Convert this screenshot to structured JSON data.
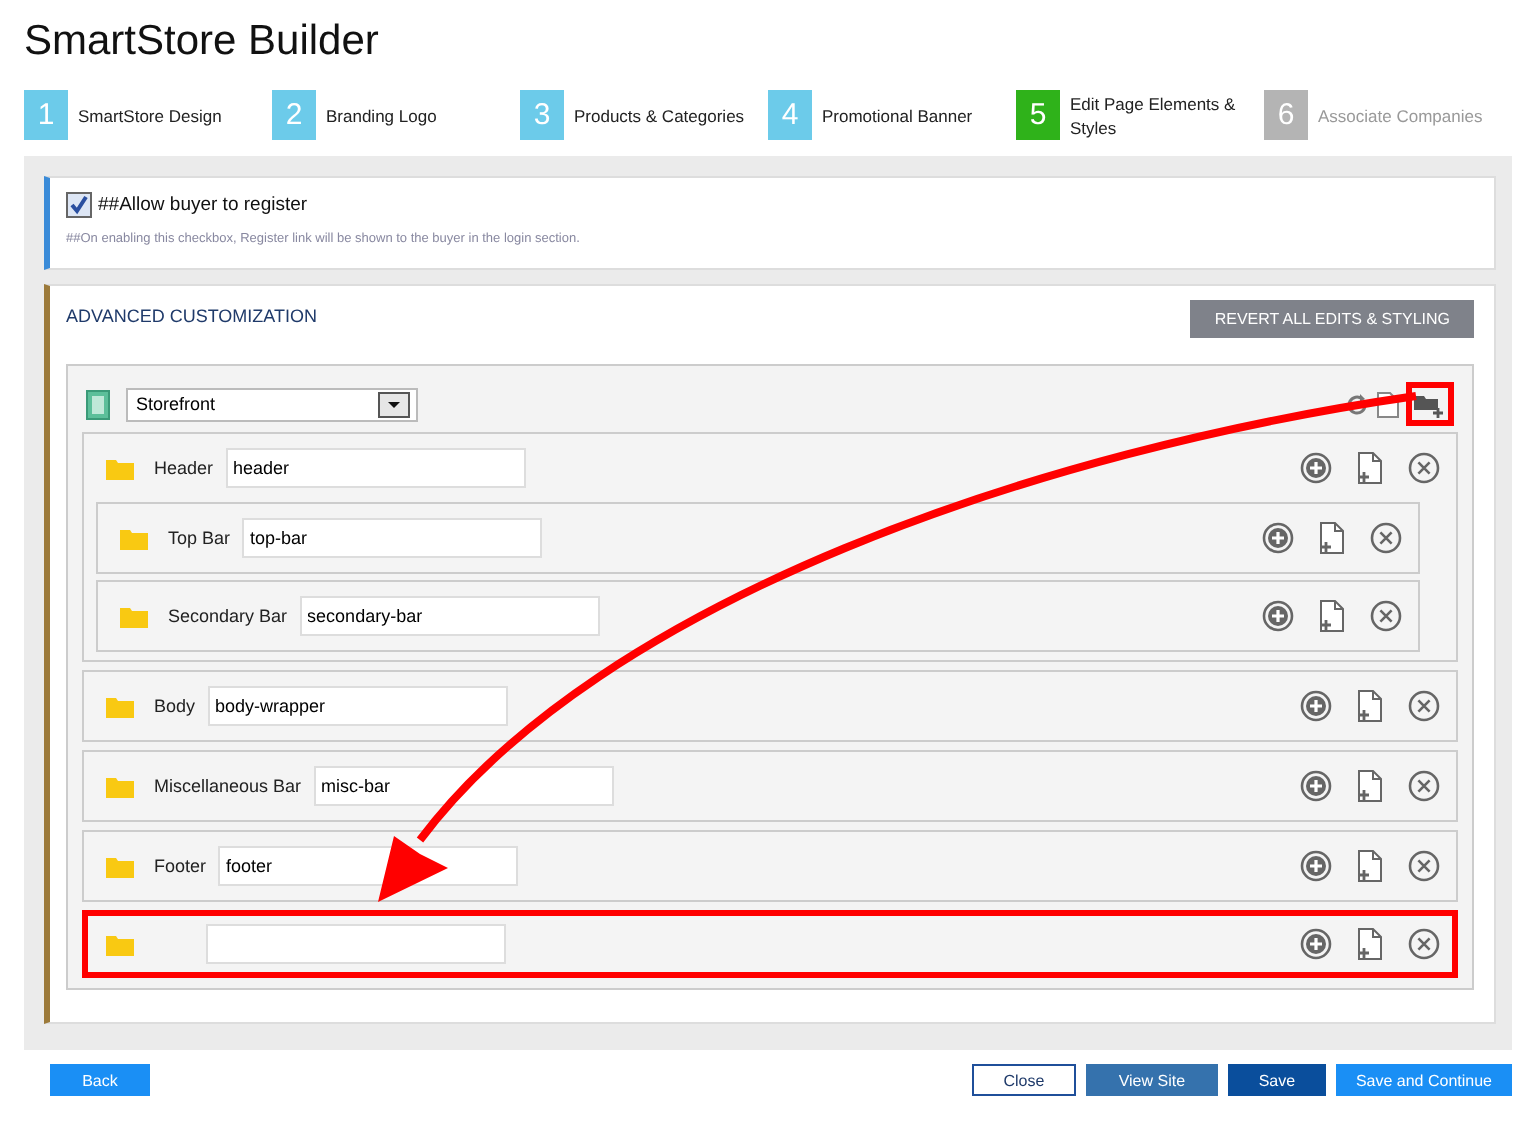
{
  "title": "SmartStore Builder",
  "steps": [
    {
      "number": "1",
      "label": "SmartStore Design",
      "selected": false,
      "disabled": false
    },
    {
      "number": "2",
      "label": "Branding Logo",
      "selected": false,
      "disabled": false
    },
    {
      "number": "3",
      "label": "Products & Categories",
      "selected": false,
      "disabled": false
    },
    {
      "number": "4",
      "label": "Promotional Banner",
      "selected": false,
      "disabled": false
    },
    {
      "number": "5",
      "label": "Edit Page Elements & Styles",
      "selected": true,
      "disabled": false
    },
    {
      "number": "6",
      "label": "Associate Companies",
      "selected": false,
      "disabled": true
    }
  ],
  "register": {
    "label": "##Allow buyer to register",
    "checked": true,
    "note": "##On enabling this checkbox, Register link will be shown to the buyer in the login section."
  },
  "advanced": {
    "title": "ADVANCED CUSTOMIZATION",
    "revert_button": "REVERT ALL EDITS & STYLING",
    "root_select": "Storefront",
    "add_folder_highlighted": true,
    "sections": [
      {
        "label": "Header",
        "value": "header",
        "highlighted": false,
        "children": [
          {
            "label": "Top Bar",
            "value": "top-bar",
            "highlighted": false
          },
          {
            "label": "Secondary Bar",
            "value": "secondary-bar",
            "highlighted": false
          }
        ]
      },
      {
        "label": "Body",
        "value": "body-wrapper",
        "highlighted": false
      },
      {
        "label": "Miscellaneous Bar",
        "value": "misc-bar",
        "highlighted": false
      },
      {
        "label": "Footer",
        "value": "footer",
        "highlighted": false
      },
      {
        "highlighted": true
      }
    ]
  },
  "footer": {
    "left_buttons": [
      {
        "label": "Back",
        "kind": "light"
      }
    ],
    "right_buttons": [
      {
        "label": "Close",
        "kind": "outline"
      },
      {
        "label": "View Site",
        "kind": "muted"
      },
      {
        "label": "Save",
        "kind": "dark"
      },
      {
        "label": "Save and Continue",
        "kind": "light"
      }
    ]
  }
}
